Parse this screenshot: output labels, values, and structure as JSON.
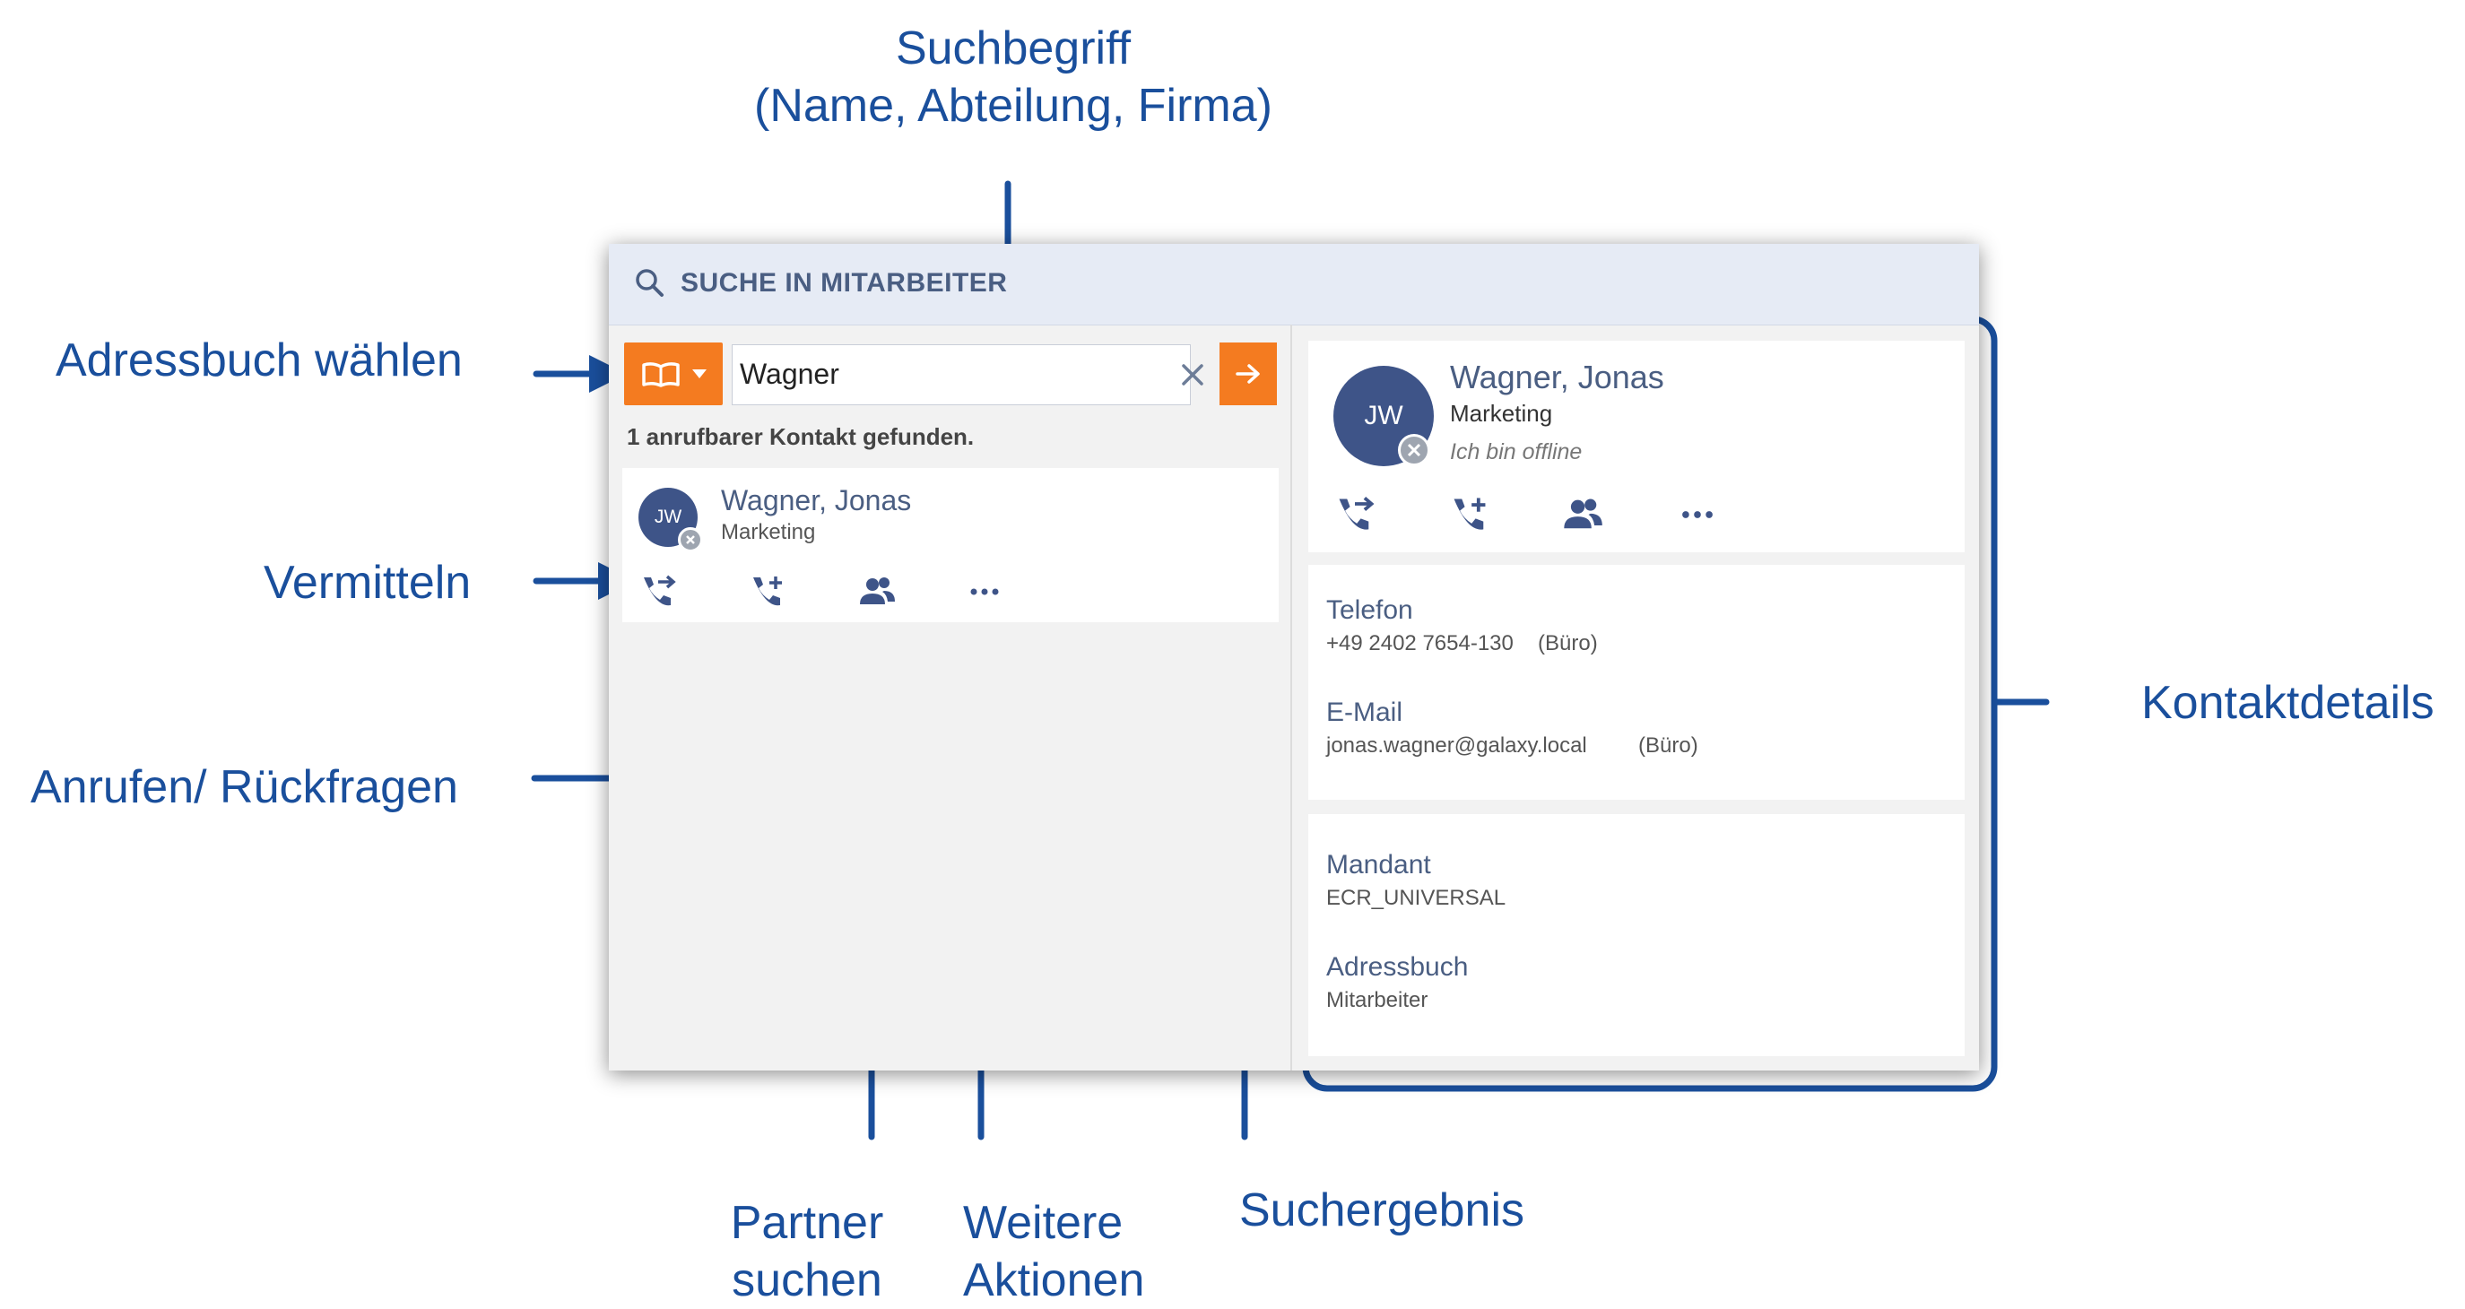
{
  "annotations": {
    "suchbegriff_line1": "Suchbegriff",
    "suchbegriff_line2": "(Name, Abteilung, Firma)",
    "adressbuch": "Adressbuch wählen",
    "vermitteln": "Vermitteln",
    "anrufen": "Anrufen/ Rückfragen",
    "kontaktdetails": "Kontaktdetails",
    "partner_line1": "Partner",
    "partner_line2": "suchen",
    "weitere_line1": "Weitere",
    "weitere_line2": "Aktionen",
    "suchergebnis": "Suchergebnis"
  },
  "window": {
    "title": "SUCHE IN MITARBEITER"
  },
  "search": {
    "value": "Wagner",
    "clear_label": "✕",
    "go_label": "→"
  },
  "results": {
    "count_text": "1 anrufbarer Kontakt gefunden.",
    "items": [
      {
        "initials": "JW",
        "name": "Wagner, Jonas",
        "department": "Marketing"
      }
    ]
  },
  "detail": {
    "initials": "JW",
    "name": "Wagner, Jonas",
    "department": "Marketing",
    "status": "Ich bin offline",
    "phone_label": "Telefon",
    "phone_value": "+49 2402 7654-130",
    "phone_type": "(Büro)",
    "email_label": "E-Mail",
    "email_value": "jonas.wagner@galaxy.local",
    "email_type": "(Büro)",
    "tenant_label": "Mandant",
    "tenant_value": "ECR_UNIVERSAL",
    "addressbook_label": "Adressbuch",
    "addressbook_value": "Mitarbeiter"
  },
  "icons": {
    "search": "search-icon",
    "addressbook": "book-icon",
    "dropdown": "caret-down-icon",
    "transfer": "transfer-call-icon",
    "call": "call-add-icon",
    "partner": "people-icon",
    "more": "more-dots-icon",
    "presence": "offline-x-icon"
  },
  "colors": {
    "accent": "#f47b20",
    "annotation": "#1a4f9c",
    "avatar": "#3e5488",
    "heading": "#4a5e82"
  }
}
